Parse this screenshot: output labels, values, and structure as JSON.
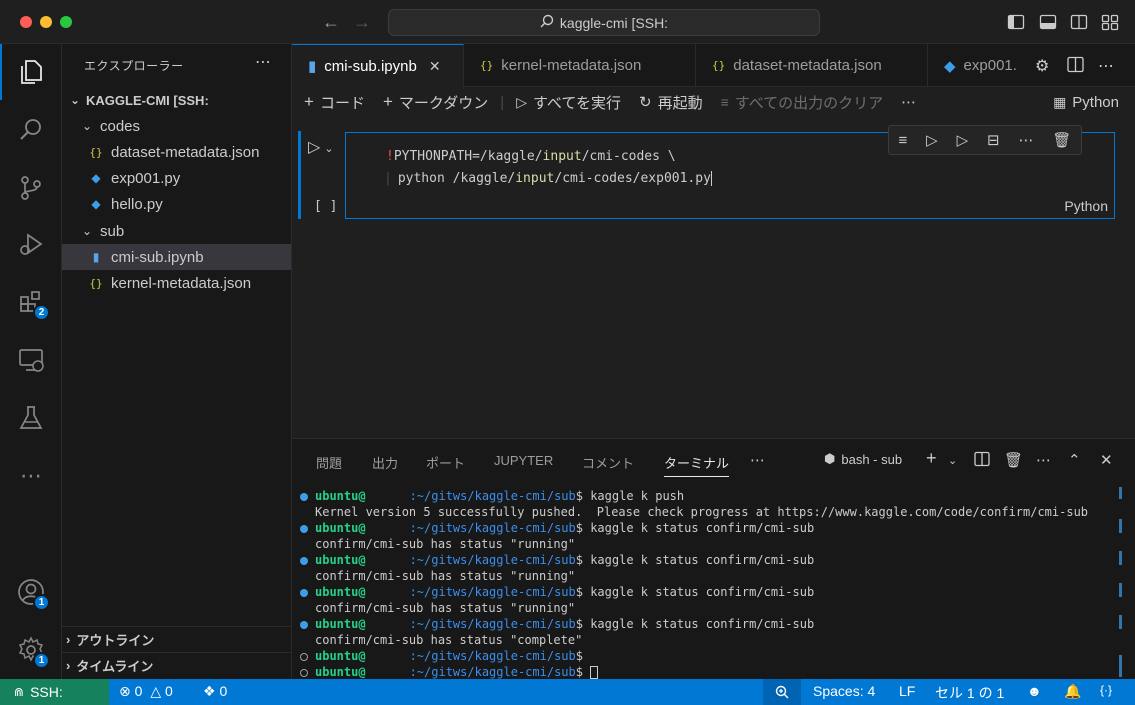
{
  "window": {
    "title": "kaggle-cmi [SSH:"
  },
  "sidebar": {
    "title": "エクスプローラー",
    "root": "KAGGLE-CMI [SSH:",
    "tree": [
      {
        "label": "codes",
        "kind": "folder"
      },
      {
        "label": "dataset-metadata.json",
        "kind": "json"
      },
      {
        "label": "exp001.py",
        "kind": "python"
      },
      {
        "label": "hello.py",
        "kind": "python"
      },
      {
        "label": "sub",
        "kind": "folder"
      },
      {
        "label": "cmi-sub.ipynb",
        "kind": "notebook"
      },
      {
        "label": "kernel-metadata.json",
        "kind": "json"
      }
    ],
    "outline": "アウトライン",
    "timeline": "タイムライン"
  },
  "activity": {
    "extensions_badge": "2",
    "accounts_badge": "1",
    "settings_badge": "1"
  },
  "tabs": [
    {
      "label": "cmi-sub.ipynb",
      "active": true
    },
    {
      "label": "kernel-metadata.json",
      "active": false
    },
    {
      "label": "dataset-metadata.json",
      "active": false
    },
    {
      "label": "exp001.",
      "active": false
    }
  ],
  "nb_toolbar": {
    "add_code": "コード",
    "add_markdown": "マークダウン",
    "run_all": "すべてを実行",
    "restart": "再起動",
    "clear_outputs": "すべての出力のクリア",
    "kernel": "Python"
  },
  "cell": {
    "line1_prefix": "!",
    "line1_a": "PYTHONPATH=/kaggle/",
    "line1_hl": "input",
    "line1_b": "/cmi-codes \\",
    "line2_a": "python /kaggle/",
    "line2_hl": "input",
    "line2_b": "/cmi-codes/exp001.py",
    "exec_count": "[ ]",
    "language": "Python"
  },
  "panel": {
    "tabs": [
      "問題",
      "出力",
      "ポート",
      "JUPYTER",
      "コメント",
      "ターミナル"
    ],
    "active_tab": "ターミナル",
    "terminal_name": "bash - sub"
  },
  "terminal": {
    "user": "ubuntu@",
    "path": ":~/gitws/kaggle-cmi/sub",
    "lines": [
      {
        "type": "prompt",
        "cmd": "kaggle k push"
      },
      {
        "type": "out",
        "text": "Kernel version 5 successfully pushed.  Please check progress at https://www.kaggle.com/code/confirm/cmi-sub"
      },
      {
        "type": "prompt",
        "cmd": "kaggle k status confirm/cmi-sub"
      },
      {
        "type": "out",
        "text": "confirm/cmi-sub has status \"running\""
      },
      {
        "type": "prompt",
        "cmd": "kaggle k status confirm/cmi-sub"
      },
      {
        "type": "out",
        "text": "confirm/cmi-sub has status \"running\""
      },
      {
        "type": "prompt",
        "cmd": "kaggle k status confirm/cmi-sub"
      },
      {
        "type": "out",
        "text": "confirm/cmi-sub has status \"running\""
      },
      {
        "type": "prompt",
        "cmd": "kaggle k status confirm/cmi-sub"
      },
      {
        "type": "out",
        "text": "confirm/cmi-sub has status \"complete\""
      },
      {
        "type": "prompt_hollow",
        "cmd": ""
      },
      {
        "type": "prompt_hollow_cursor",
        "cmd": ""
      }
    ]
  },
  "statusbar": {
    "remote": "SSH:",
    "errors": "0",
    "warnings": "0",
    "ports": "0",
    "spaces": "Spaces: 4",
    "eol": "LF",
    "cell_pos": "セル 1 の 1"
  },
  "colors": {
    "accent": "#0078d4",
    "remote_bg": "#16825d",
    "user_green": "#23d18b",
    "path_blue": "#3b8eea"
  }
}
